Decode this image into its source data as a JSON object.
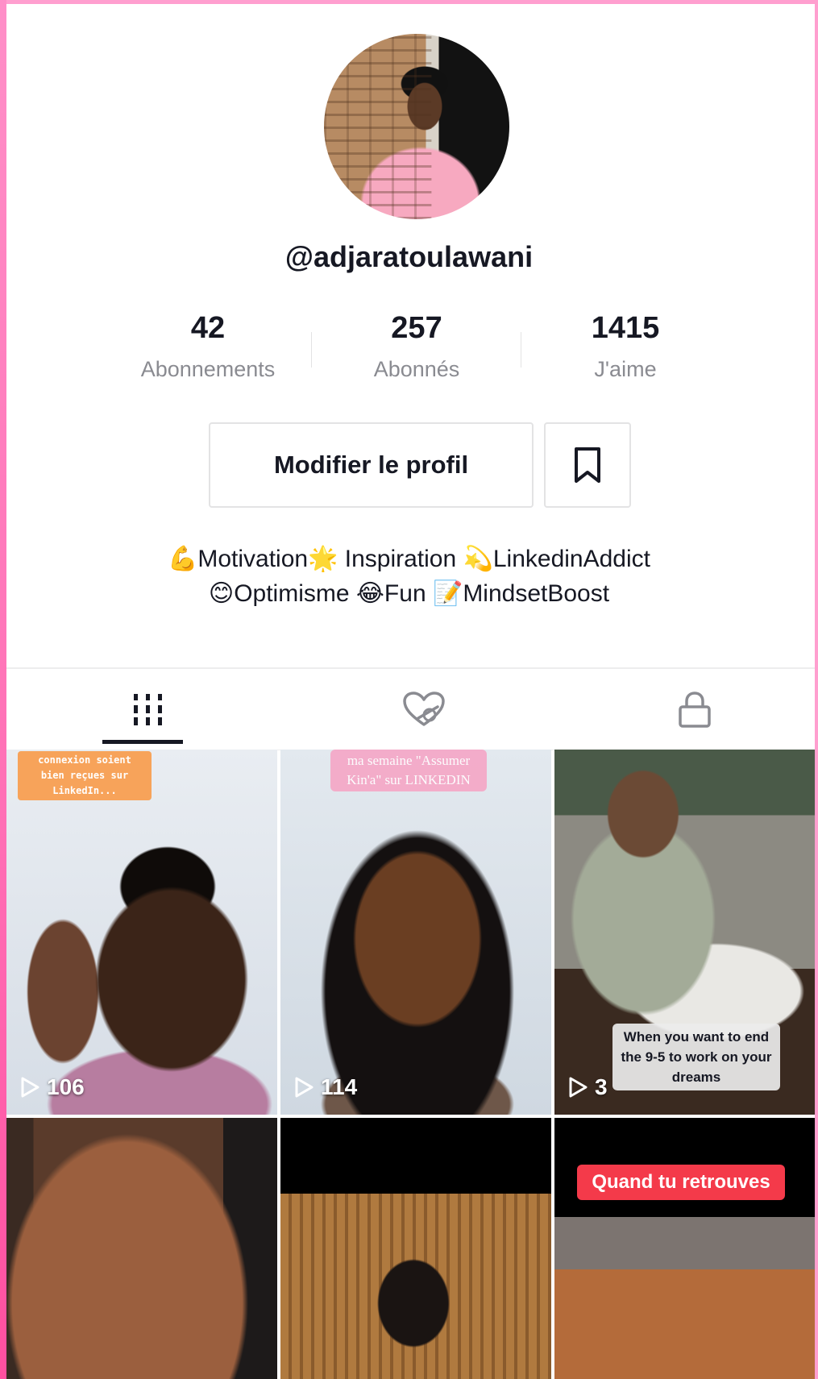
{
  "profile": {
    "username": "@adjaratoulawani"
  },
  "stats": [
    {
      "value": "42",
      "label": "Abonnements"
    },
    {
      "value": "257",
      "label": "Abonnés"
    },
    {
      "value": "1415",
      "label": "J'aime"
    }
  ],
  "actions": {
    "edit_profile_label": "Modifier le profil"
  },
  "bio": {
    "line1": "💪Motivation🌟 Inspiration 💫LinkedinAddict",
    "line2": "😊Optimisme 😂Fun 📝MindsetBoost"
  },
  "tabs": [
    {
      "icon": "grid-icon",
      "active": true
    },
    {
      "icon": "liked-hidden-icon",
      "active": false
    },
    {
      "icon": "lock-icon",
      "active": false
    }
  ],
  "videos": [
    {
      "views": "106",
      "caption": "connexion soient bien reçues sur LinkedIn..."
    },
    {
      "views": "114",
      "caption": "ma semaine \"Assumer Kin'a\" sur LINKEDIN"
    },
    {
      "views": "3",
      "caption": "When you want to end the 9-5 to work on your dreams"
    },
    {
      "views": "",
      "caption": ""
    },
    {
      "views": "",
      "caption": ""
    },
    {
      "views": "",
      "caption": "Quand tu retrouves"
    }
  ],
  "colors": {
    "text_primary": "#161823",
    "text_secondary": "#8a8b91",
    "border": "#e3e3e4",
    "caption_red": "#f43a4a"
  }
}
